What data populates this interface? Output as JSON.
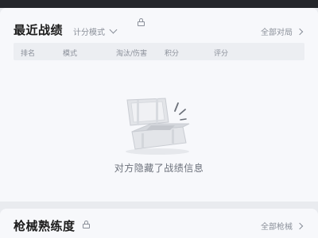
{
  "recent_battles": {
    "title": "最近战绩",
    "mode_label": "计分模式",
    "all_link": "全部对局",
    "columns": [
      "排名",
      "模式",
      "淘汰/伤害",
      "积分",
      "评分"
    ],
    "empty_text": "对方隐藏了战绩信息"
  },
  "weapon_proficiency": {
    "title": "枪械熟练度",
    "all_link": "全部枪械"
  }
}
